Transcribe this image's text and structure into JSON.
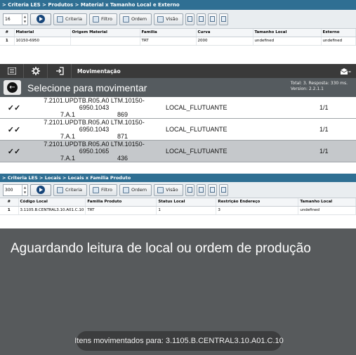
{
  "panel1": {
    "breadcrumb": "> Criteria LES > Produtos > Material x Tamanho Local e Externo",
    "toolbar": {
      "spin_value": "16",
      "criteria": "Criteria",
      "filtro": "Filtro",
      "ordem": "Ordem",
      "visao": "Visão"
    },
    "columns": [
      "#",
      "Material",
      "Origem Material",
      "Familia",
      "Curva",
      "Tamanho Local",
      "Externo"
    ],
    "rows": [
      {
        "num": "1",
        "material": "10150-6950",
        "origem": "",
        "familia": "TRT",
        "curva": "2000",
        "tamanho": "undefined",
        "externo": "undefined"
      }
    ]
  },
  "panel2": {
    "header_title": "Movimentação",
    "subtitle": "Selecione para movimentar",
    "info_line1": "Total: 3. Resposta: 330 ms.",
    "info_line2": "Version: 2.2.1.1",
    "items": [
      {
        "code1": "7.2101.UPDTB.R05.A0  LTM.10150-6950.1043",
        "code2": "7.A.1                        869",
        "loc": "LOCAL_FLUTUANTE",
        "qty": "1/1"
      },
      {
        "code1": "7.2101.UPDTB.R05.A0  LTM.10150-6950.1043",
        "code2": "7.A.1                        871",
        "loc": "LOCAL_FLUTUANTE",
        "qty": "1/1"
      },
      {
        "code1": "7.2101.UPDTB.R05.A0  LTM.10150-6950.1065",
        "code2": "7.A.1                        436",
        "loc": "LOCAL_FLUTUANTE",
        "qty": "1/1"
      }
    ]
  },
  "panel3": {
    "breadcrumb": "> Criteria LES > Locais > Locais x Familia Produto",
    "toolbar": {
      "spin_value": "300",
      "criteria": "Criteria",
      "filtro": "Filtro",
      "ordem": "Ordem",
      "visao": "Visão"
    },
    "columns": [
      "#",
      "Código Local",
      "Familia Produto",
      "Status Local",
      "Restrição Endereço",
      "Tamanho Local"
    ],
    "rows": [
      {
        "num": "1",
        "codigo": "3.1105.B.CENTRAL3.10.A01.C.10",
        "familia": "TRT",
        "status": "1",
        "restricao": "3",
        "tamanho": "undefined"
      }
    ]
  },
  "panel4": {
    "message": "Aguardando leitura de local ou ordem de produção",
    "toast": "Itens movimentados para: 3.1105.B.CENTRAL3.10.A01.C.10"
  }
}
